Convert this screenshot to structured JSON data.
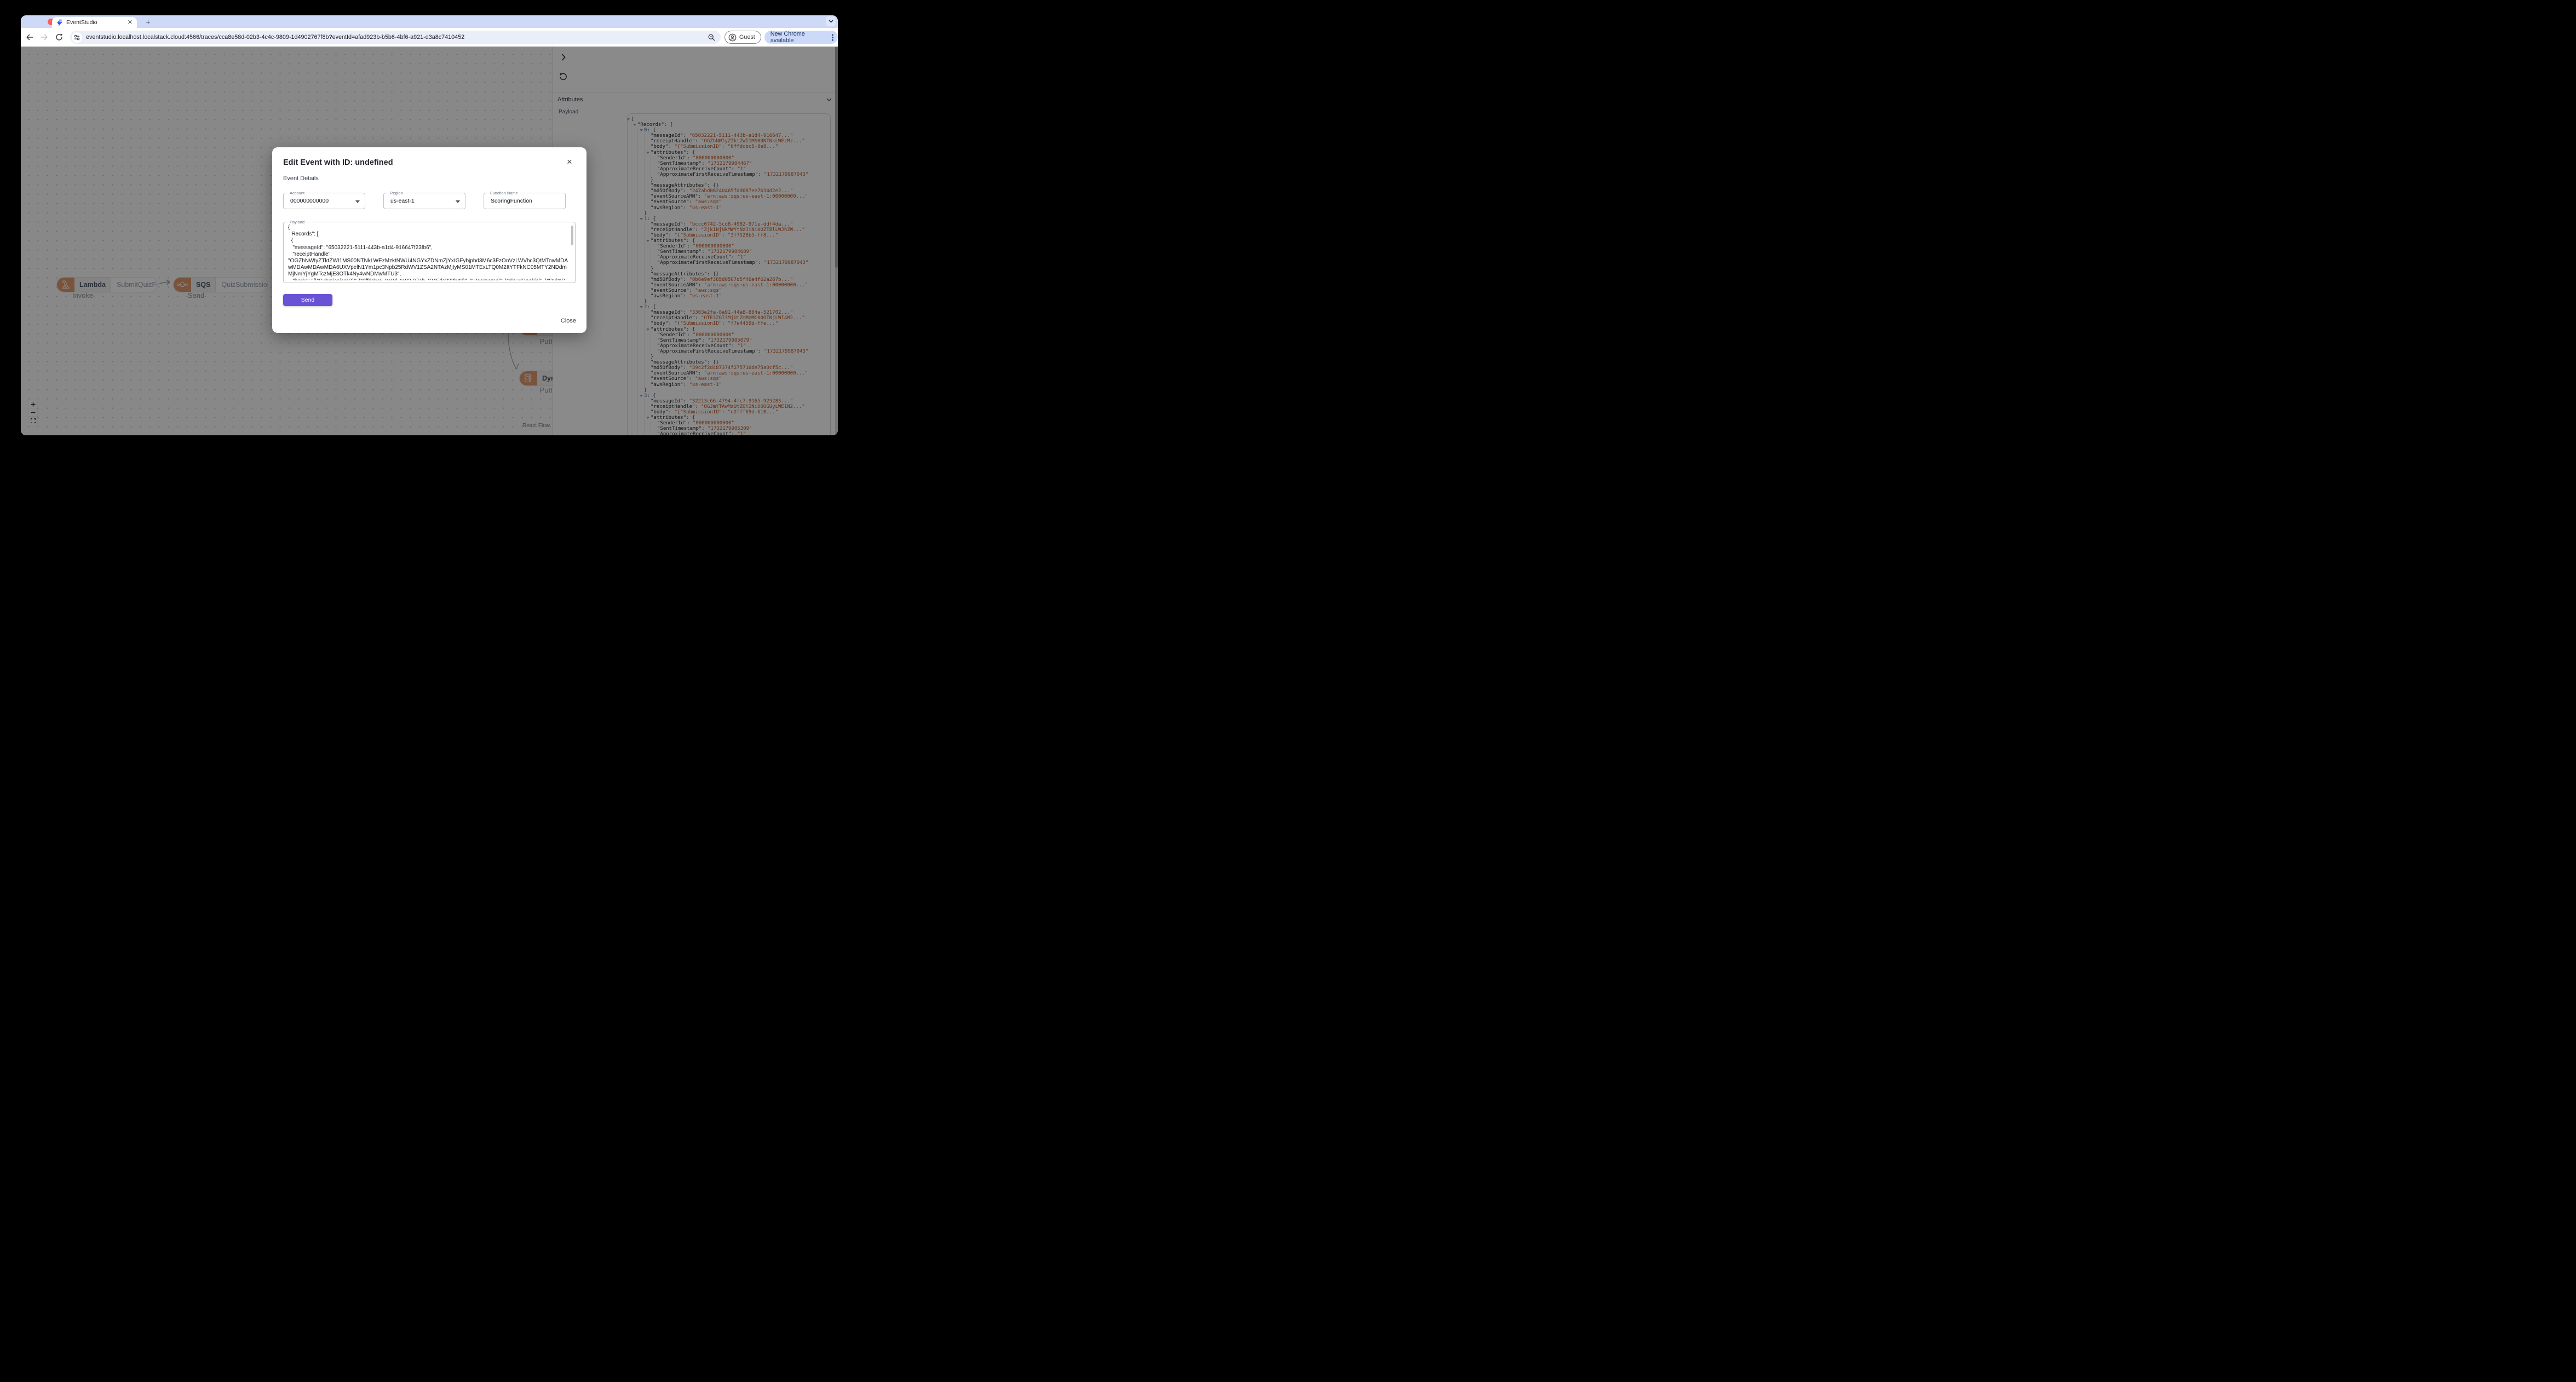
{
  "browser": {
    "tab_title": "EventStudio",
    "url": "eventstudio.localhost.localstack.cloud:4566/traces/cca8e58d-02b3-4c4c-9809-1d4902767f8b?eventId=afad923b-b5b6-4bf6-a921-d3a8c7410452",
    "guest_label": "Guest",
    "update_label": "New Chrome available"
  },
  "canvas": {
    "nodes": [
      {
        "service": "Lambda",
        "resource": "SubmitQuizFunction",
        "action": "Invoke"
      },
      {
        "service": "SQS",
        "resource": "QuizSubmissionQueue",
        "action": "Send"
      },
      {
        "service": "DynamoDB",
        "resource": "",
        "action": "PutItem"
      },
      {
        "service": "DynamoDB",
        "resource": "",
        "action": "PutItem"
      }
    ],
    "attribution": "React Flow"
  },
  "panel": {
    "attributes_label": "Attributes",
    "payload_label": "Payload",
    "records": [
      {
        "index": "0",
        "messageId": "65032221-5111-443b-a1d4-916647...",
        "receiptHandle": "OGZhNWIyZTktZWI1MS00NTNkLWEzMz...",
        "body": "{\"SubmissionID\": \"6ffdcbc5-8e8...",
        "attributes": {
          "SenderId": "000000000000",
          "SentTimestamp": "1732179984467",
          "ApproximateReceiveCount": "1",
          "ApproximateFirstReceiveTimestamp": "1732179987043"
        },
        "md5OfBody": "247abd08240465fdd687ee7b34d2e2...",
        "eventSourceARN": "arn:aws:sqs:us-east-1:00000000...",
        "eventSource": "aws:sqs",
        "awsRegion": "us-east-1",
        "truncated": false
      },
      {
        "index": "1",
        "messageId": "bccc0742-5cd8-4982-971e-ddf4da...",
        "receiptHandle": "Zjk1NjNkMWYtNzJiNi00ZTBlLWJhZW...",
        "body": "{\"SubmissionID\": \"3f7528b5-ff8...",
        "attributes": {
          "SenderId": "000000000000",
          "SentTimestamp": "1732179984689",
          "ApproximateReceiveCount": "1",
          "ApproximateFirstReceiveTimestamp": "1732179987043"
        },
        "md5OfBody": "0b6e9ef385d0507d5f46e4f62a267b...",
        "eventSourceARN": "arn:aws:sqs:us-east-1:00000000...",
        "eventSource": "aws:sqs",
        "awsRegion": "us-east-1",
        "truncated": false
      },
      {
        "index": "2",
        "messageId": "3303e2fa-8a91-44a8-884a-521702...",
        "receiptHandle": "OTE3ZGI3MjUtZmMzMC00OTNjLWI4M2...",
        "body": "{\"SubmissionID\": \"f7e4459d-ffe...",
        "attributes": {
          "SenderId": "000000000000",
          "SentTimestamp": "1732179985079",
          "ApproximateReceiveCount": "1",
          "ApproximateFirstReceiveTimestamp": "1732179987043"
        },
        "md5OfBody": "39c2f2d487374f275716de75a0cf5c...",
        "eventSourceARN": "arn:aws:sqs:us-east-1:00000000...",
        "eventSource": "aws:sqs",
        "awsRegion": "us-east-1",
        "truncated": false
      },
      {
        "index": "3",
        "messageId": "32213c66-4794-4fc7-9165-925283...",
        "receiptHandle": "OGJmYTAwMzUtZGY2Ni00OGUyLWE1N2...",
        "body": "{\"SubmissionID\": \"e2fff69d-610...",
        "attributes": {
          "SenderId": "000000000000",
          "SentTimestamp": "1732179985309",
          "ApproximateReceiveCount": "1"
        },
        "truncated": true
      }
    ]
  },
  "modal": {
    "title": "Edit Event with ID: undefined",
    "section_label": "Event Details",
    "fields": [
      {
        "label": "Account",
        "value": "000000000000"
      },
      {
        "label": "Region",
        "value": "us-east-1"
      },
      {
        "label": "Function Name",
        "value": "ScoringFunction"
      }
    ],
    "payload_label": "Payload",
    "payload_text": "{\n \"Records\": [\n  {\n   \"messageId\": \"65032221-5111-443b-a1d4-916647f23fb6\",\n   \"receiptHandle\":\n\"OGZhNWIyZTktZWI1MS00NTNkLWEzMzktNWU4NGYxZDNmZjYxIGFybjphd3M6c3FzOnVzLWVhc3QtMTowMDAwMDAwMDAwMDA6UXVpelN1Ym1pc3Npb25RdWV1ZSA2NTAzMjIyMS01MTExLTQ0M2ItYTFkNC05MTY2NDdmMjNmYjYgMTczMjE3OTk4Ny4wNDMwMTU3\",\n   \"body\": \"{\\\"SubmissionID\\\": \\\"6ffdcbc5-8e8d-4a82-97eb-4245de222b48\\\", \\\"Username\\\": \\\"cloudRookie\\\", \\\"QuizID\\\": \\\"adorable-",
    "send_label": "Send",
    "close_label": "Close"
  },
  "colors": {
    "accent_purple": "#6952d5",
    "aws_orange": "#df9a70",
    "tabstrip_blue": "#cdd9f7",
    "update_pill_blue": "#ccd9f8",
    "update_text_navy": "#1c3264",
    "json_string": "#c2551f",
    "json_index": "#3b82c4",
    "traffic_red": "#ff5f57",
    "traffic_yellow": "#febc2e",
    "traffic_green": "#28c840"
  }
}
